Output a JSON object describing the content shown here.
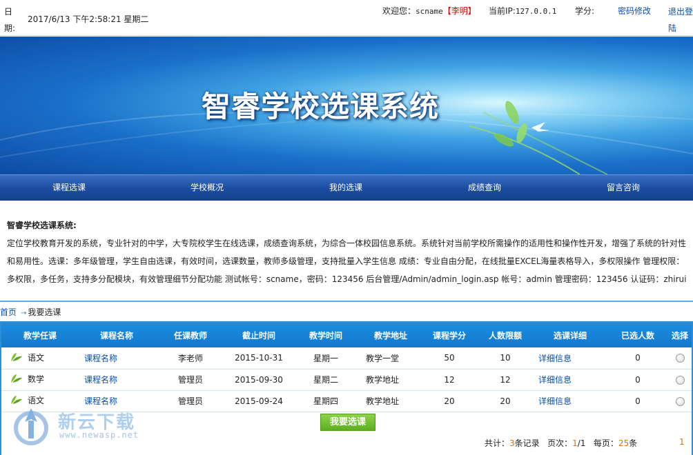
{
  "top": {
    "date_label": "日期:",
    "date_value": "2017/6/13 下午2:58:21 星期二",
    "welcome_prefix": "欢迎您：",
    "username": "scname",
    "realname": "【李明】",
    "ip_label": "当前IP:",
    "ip_value": "127.0.0.1",
    "score_label": "学分:",
    "change_password": "密码修改",
    "logout": "退出登陆"
  },
  "banner": {
    "title": "智睿学校选课系统"
  },
  "nav": [
    {
      "label": "课程选课"
    },
    {
      "label": "学校概况"
    },
    {
      "label": "我的选课"
    },
    {
      "label": "成绩查询"
    },
    {
      "label": "留言咨询"
    }
  ],
  "intro": {
    "title": "智睿学校选课系统:",
    "text": "定位学校教育开发的系统，专业针对的中学，大专院校学生在线选课，成绩查询系统，为综合一体校园信息系统。系统针对当前学校所需操作的适用性和操作性开发，增强了系统的针对性和易用性。选课：多年级管理，学生自由选课，有效时间，选课数量，教师多级管理，支持批量入学生信息 成绩：专业自由分配，在线批量EXCEL海量表格导入，多权限操作 管理权限：多权限，多任务，支持多分配模块，有效管理细节分配功能 测试帐号：scname，密码：123456 后台管理/Admin/admin_login.asp   帐号：admin 管理密码：123456   认证码：zhirui"
  },
  "breadcrumb": {
    "home": "首页",
    "current": "我要选课"
  },
  "table": {
    "headers": [
      "教学任课",
      "课程名称",
      "任课教师",
      "截止时间",
      "教学时间",
      "教学地址",
      "课程学分",
      "人数限额",
      "选课详细",
      "已选人数",
      "选择"
    ],
    "rows": [
      {
        "subject": "语文",
        "course": "课程名称",
        "teacher": "李老师",
        "deadline": "2015-10-31",
        "time": "星期一",
        "place": "教学一堂",
        "credit": "50",
        "limit": "10",
        "detail": "详细信息",
        "enrolled": "0"
      },
      {
        "subject": "数学",
        "course": "课程名称",
        "teacher": "管理员",
        "deadline": "2015-09-30",
        "time": "星期二",
        "place": "教学地址",
        "credit": "12",
        "limit": "12",
        "detail": "详细信息",
        "enrolled": "0"
      },
      {
        "subject": "语文",
        "course": "课程名称",
        "teacher": "管理员",
        "deadline": "2015-09-24",
        "time": "星期四",
        "place": "教学地址",
        "credit": "20",
        "limit": "20",
        "detail": "详细信息",
        "enrolled": "0"
      }
    ]
  },
  "submit_label": "我要选课",
  "pager": {
    "total_prefix": "共计：",
    "total": "3",
    "total_suffix": "条记录",
    "page_prefix": "页次：",
    "page_current": "1",
    "page_total": "/1",
    "per_prefix": "每页：",
    "per": "25",
    "per_suffix": "条",
    "page_link": "1"
  },
  "watermark": {
    "text": "新云下载",
    "url": "www.newasp.net"
  },
  "colors": {
    "nav": "#1c4ea2",
    "table_header": "#1c8ee0",
    "accent_orange": "#e07000",
    "link": "#0a4ea8"
  }
}
